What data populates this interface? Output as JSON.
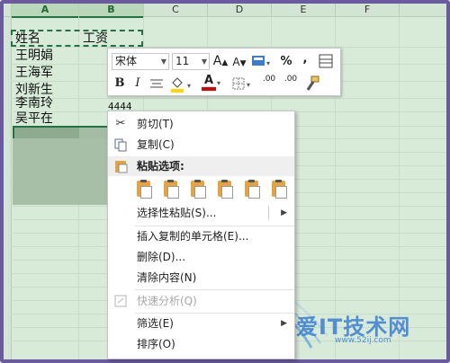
{
  "columns": [
    "A",
    "B",
    "C",
    "D",
    "E",
    "F"
  ],
  "cells": {
    "a1": "姓名",
    "b1": "工资",
    "a2": "王明娟",
    "a3": "王海军",
    "a4": "刘新生",
    "a5": "李南玲",
    "b5": "4444",
    "a6": "吴平在"
  },
  "mini_toolbar": {
    "font_name": "宋体",
    "font_size": "11",
    "grow_font": "A",
    "shrink_font": "A",
    "percent": "%",
    "comma": ",",
    "bold": "B",
    "italic": "I",
    "font_color_glyph": "A",
    "inc_decimal": ".00",
    "dec_decimal": ".00",
    "fill_color": "#ffd800",
    "font_color": "#e00000"
  },
  "context_menu": {
    "cut": "剪切(T)",
    "copy": "复制(C)",
    "paste_options": "粘贴选项:",
    "paste_special": "选择性粘贴(S)...",
    "insert_copied": "插入复制的单元格(E)...",
    "delete": "删除(D)...",
    "clear": "清除内容(N)",
    "quick_analysis": "快速分析(Q)",
    "filter": "筛选(E)",
    "sort": "排序(O)"
  },
  "watermark": {
    "title": "我爱IT技术网",
    "url": "www.52ij.com"
  }
}
